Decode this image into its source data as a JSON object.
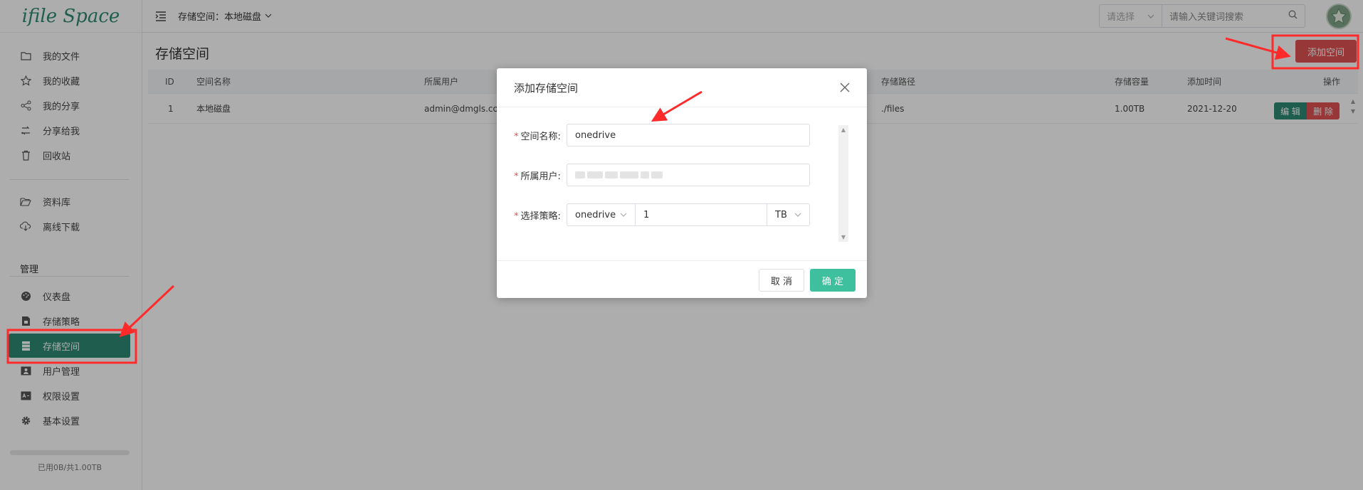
{
  "app": {
    "logo_text": "ifile Space"
  },
  "sidebar": {
    "items": [
      {
        "label": "我的文件",
        "icon": "folder-icon"
      },
      {
        "label": "我的收藏",
        "icon": "star-icon"
      },
      {
        "label": "我的分享",
        "icon": "share-icon"
      },
      {
        "label": "分享给我",
        "icon": "shared-with-me-icon"
      },
      {
        "label": "回收站",
        "icon": "trash-icon"
      },
      {
        "label": "资料库",
        "icon": "folder-open-icon"
      },
      {
        "label": "离线下载",
        "icon": "cloud-download-icon"
      }
    ],
    "section_title": "管理",
    "admin_items": [
      {
        "label": "仪表盘",
        "icon": "dashboard-icon"
      },
      {
        "label": "存储策略",
        "icon": "storage-policy-icon"
      },
      {
        "label": "存储空间",
        "icon": "storage-space-icon",
        "active": true
      },
      {
        "label": "用户管理",
        "icon": "user-manage-icon"
      },
      {
        "label": "权限设置",
        "icon": "permission-icon"
      },
      {
        "label": "基本设置",
        "icon": "gear-icon"
      }
    ],
    "usage_text": "已用0B/共1.00TB",
    "usage_fraction": 0.0
  },
  "header": {
    "title": "存储空间：本地磁盘",
    "search_select_placeholder": "请选择",
    "search_placeholder": "请输入关键词搜索"
  },
  "main": {
    "page_title": "存储空间",
    "add_button": "添加空间",
    "table": {
      "columns": [
        "ID",
        "空间名称",
        "所属用户",
        "存储路径",
        "存储容量",
        "添加时间",
        "操作"
      ],
      "rows": [
        {
          "id": "1",
          "name": "本地磁盘",
          "owner": "admin@dmgls.com",
          "path": "./files",
          "capacity": "1.00TB",
          "date": "2021-12-20"
        }
      ],
      "edit_label": "编 辑",
      "delete_label": "删 除"
    }
  },
  "dialog": {
    "title": "添加存储空间",
    "fields": {
      "name_label": "空间名称:",
      "name_value": "onedrive",
      "owner_label": "所属用户:",
      "policy_label": "选择策略:",
      "policy_value": "onedrive",
      "capacity_value": "1",
      "unit_value": "TB"
    },
    "cancel": "取 消",
    "confirm": "确 定"
  },
  "colors": {
    "primary": "#2e8b73",
    "confirm": "#3ebf9e",
    "danger": "#e05252",
    "annotation": "#ff2a2a"
  }
}
